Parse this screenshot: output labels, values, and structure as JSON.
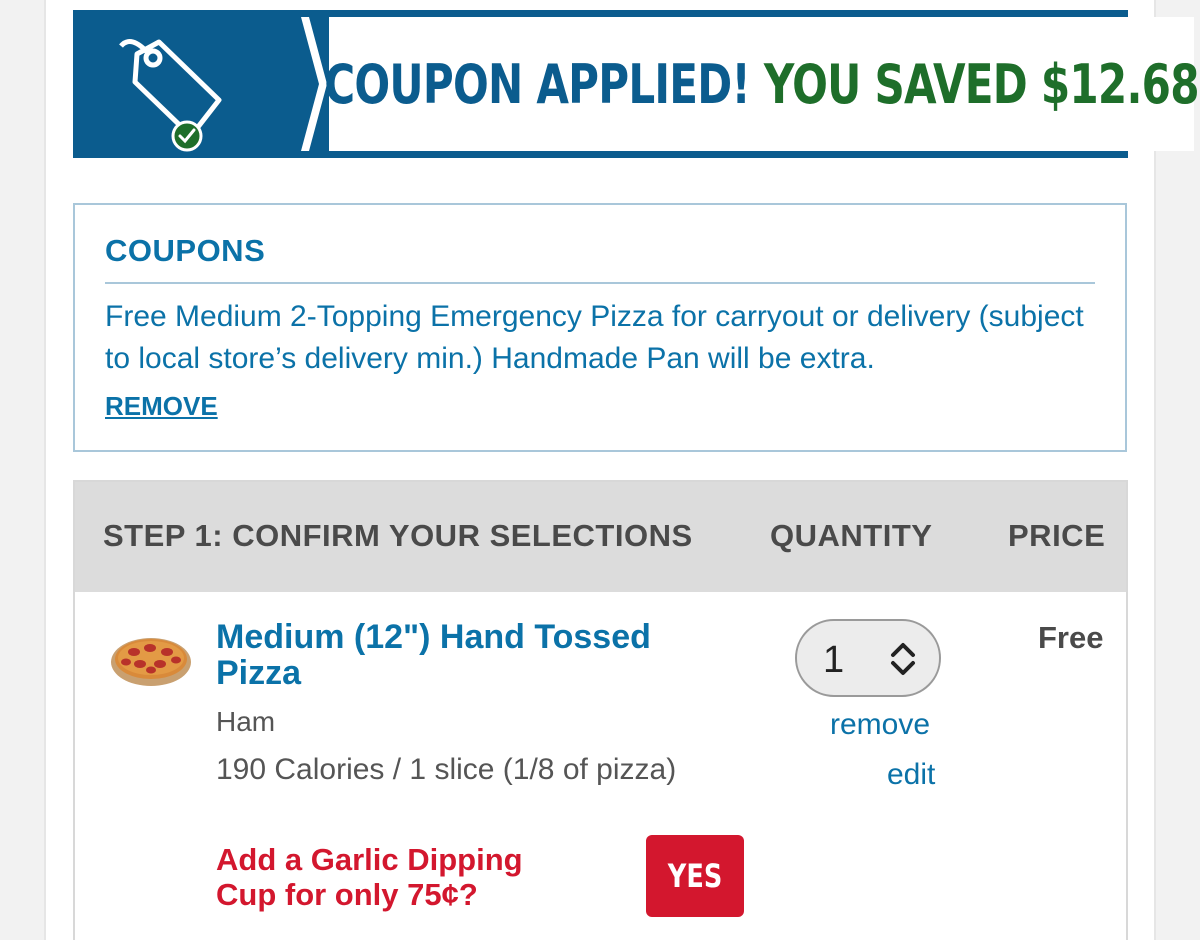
{
  "banner": {
    "applied_text": "COUPON APPLIED!",
    "saved_text": "YOU SAVED $12.68",
    "icon": "tag-check-icon",
    "colors": {
      "brand_blue": "#0b5c8e",
      "saved_green": "#1e6e2a"
    }
  },
  "coupons": {
    "title": "COUPONS",
    "description": "Free Medium 2-Topping Emergency Pizza for carryout or delivery (subject to local store’s delivery min.) Handmade Pan will be extra.",
    "remove_label": "REMOVE"
  },
  "step": {
    "headers": {
      "selections": "STEP 1: CONFIRM YOUR SELECTIONS",
      "quantity": "QUANTITY",
      "price": "PRICE"
    },
    "item": {
      "image_icon": "pizza-icon",
      "name": "Medium (12\") Hand Tossed Pizza",
      "topping": "Ham",
      "calories": "190 Calories / 1 slice (1/8 of pizza)",
      "quantity": "1",
      "remove_label": "remove",
      "edit_label": "edit",
      "price": "Free"
    },
    "upsell": {
      "text": "Add a Garlic Dipping Cup for only 75¢?",
      "button_label": "YES",
      "color": "#d3172e"
    }
  }
}
